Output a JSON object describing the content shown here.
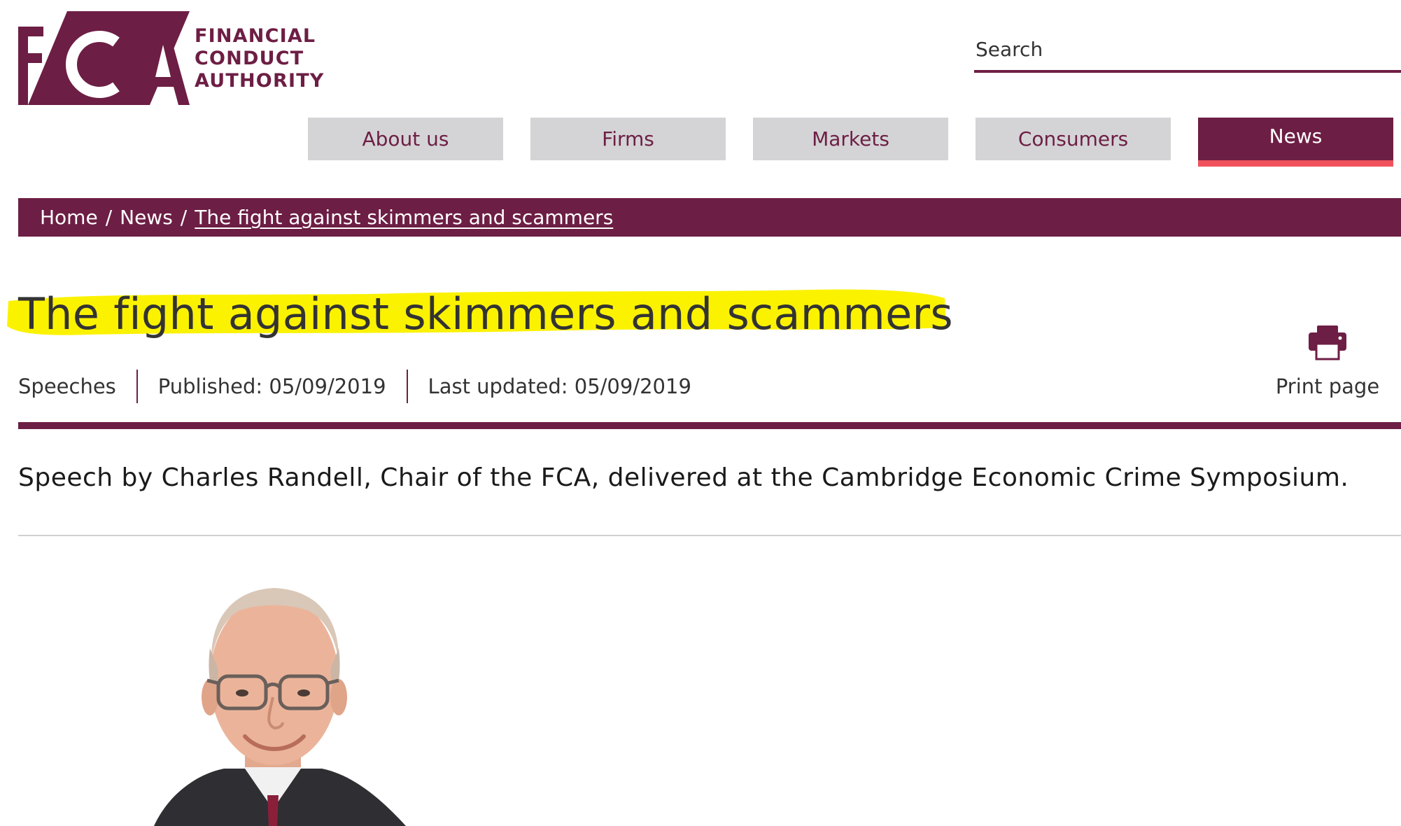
{
  "logo": {
    "mark_text": "FCA",
    "words": [
      "FINANCIAL",
      "CONDUCT",
      "AUTHORITY"
    ]
  },
  "search": {
    "placeholder": "Search"
  },
  "nav": {
    "tabs": [
      {
        "label": "About us"
      },
      {
        "label": "Firms"
      },
      {
        "label": "Markets"
      },
      {
        "label": "Consumers"
      },
      {
        "label": "News",
        "active": true
      }
    ]
  },
  "breadcrumb": {
    "items": [
      "Home",
      "News",
      "The fight against skimmers and scammers"
    ],
    "separator": "/"
  },
  "page": {
    "title": "The fight against skimmers and scammers",
    "type": "Speeches",
    "published": "Published: 05/09/2019",
    "last_updated": "Last updated: 05/09/2019",
    "print_label": "Print page",
    "summary": "Speech by Charles Randell, Chair of the FCA, delivered at the Cambridge Economic Crime Symposium."
  },
  "colors": {
    "brand": "#6d1e44",
    "active_underline": "#f0525d",
    "highlight": "#fbf200",
    "nav_bg": "#d4d4d6"
  },
  "icons": [
    "fca-logo-icon",
    "printer-icon"
  ]
}
